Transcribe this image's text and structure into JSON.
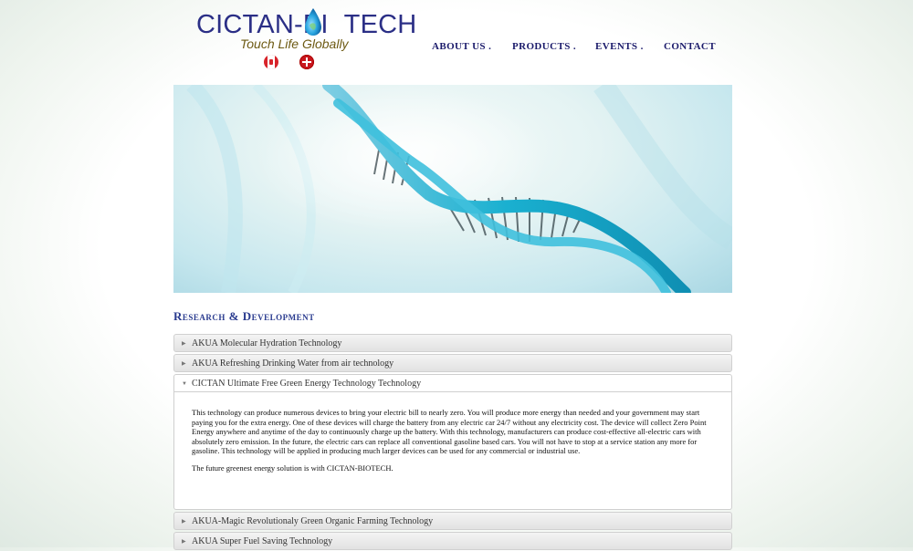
{
  "header": {
    "logo_text_left": "CICTAN-BI",
    "logo_text_right": "TECH",
    "tagline": "Touch Life Globally"
  },
  "nav": {
    "about": "ABOUT US .",
    "products": "PRODUCTS .",
    "events": "EVENTS .",
    "contact": "CONTACT"
  },
  "section": {
    "title": "Research & Development"
  },
  "accordion": {
    "items": [
      {
        "label": "AKUA Molecular Hydration Technology",
        "expanded": false
      },
      {
        "label": "AKUA Refreshing Drinking Water from air technology",
        "expanded": false
      },
      {
        "label": "CICTAN Ultimate Free Green Energy Technology Technology",
        "expanded": true,
        "paragraph1": "This technology can produce numerous devices to bring your electric bill to nearly zero. You will produce more energy than needed and your government may start paying you for the extra energy. One of these devices will charge the battery from any electric car 24/7 without any electricity cost. The device will collect Zero Point Energy anywhere and anytime of the day to continuously charge up the battery. With this technology, manufacturers can produce cost-effective all-electric cars with absolutely zero emission. In the future, the electric cars can replace all conventional gasoline based cars. You will not have to stop at a service station any more for gasoline. This technology will be applied in producing much larger devices can be used for any commercial or industrial use.",
        "paragraph2": "The future greenest energy solution is with CICTAN-BIOTECH."
      },
      {
        "label": "AKUA-Magic Revolutionaly Green Organic Farming Technology",
        "expanded": false
      },
      {
        "label": "AKUA Super Fuel Saving Technology",
        "expanded": false
      }
    ]
  },
  "colors": {
    "brand_navy": "#2b2f86",
    "tagline_gold": "#6d5a13",
    "nav_text": "#1b1b6b",
    "section_title": "#2a3b8f",
    "drop_blue": "#1e9bd7"
  }
}
